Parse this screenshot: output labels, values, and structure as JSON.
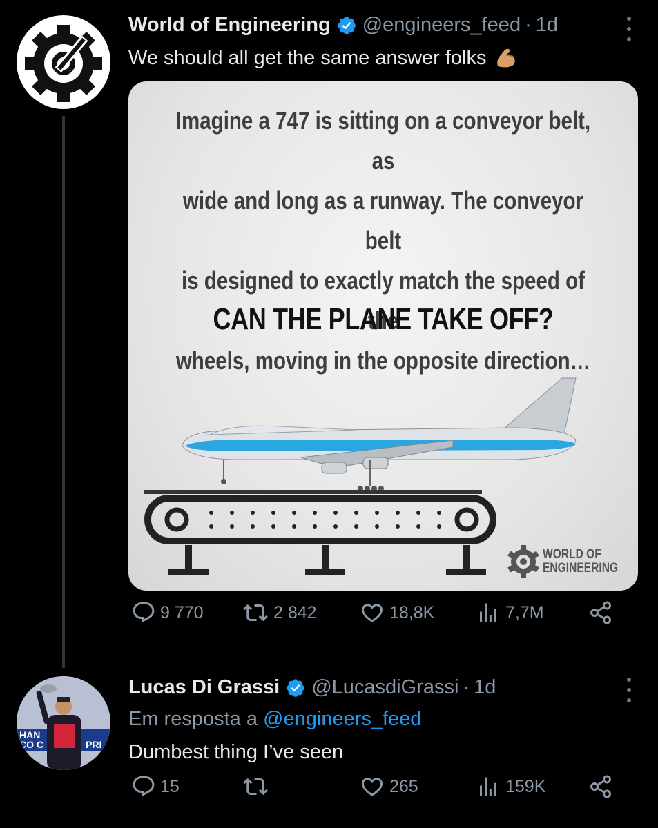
{
  "tweet1": {
    "author_name": "World of Engineering",
    "author_handle": "@engineers_feed",
    "dot": "·",
    "time": "1d",
    "text": "We should all get the same answer folks",
    "emoji": "flexed-biceps",
    "media": {
      "question": [
        "Imagine a 747 is sitting on a conveyor belt, as",
        "wide and long as a runway. The conveyor belt",
        "is designed to exactly match the speed of the",
        "wheels, moving in the opposite direction…"
      ],
      "headline": "CAN THE PLANE TAKE OFF?",
      "watermark_line1": "WORLD OF",
      "watermark_line2": "ENGINEERING"
    },
    "stats": {
      "replies": "9 770",
      "reposts": "2 842",
      "likes": "18,8K",
      "views": "7,7M"
    }
  },
  "tweet2": {
    "author_name": "Lucas Di Grassi",
    "author_handle": "@LucasdiGrassi",
    "dot": "·",
    "time": "1d",
    "reply_prefix": "Em resposta a",
    "reply_mention": "@engineers_feed",
    "text": "Dumbest thing I’ve seen",
    "stats": {
      "replies": "15",
      "reposts": "",
      "likes": "265",
      "views": "159K"
    }
  },
  "colors": {
    "background": "#000000",
    "text": "#e7e9ea",
    "secondary": "#8b98a5",
    "link": "#1d9bf0",
    "verified": "#1d9bf0"
  },
  "icons": [
    "reply-icon",
    "repost-icon",
    "like-icon",
    "views-icon",
    "share-icon",
    "more-icon",
    "verified-badge-icon"
  ]
}
